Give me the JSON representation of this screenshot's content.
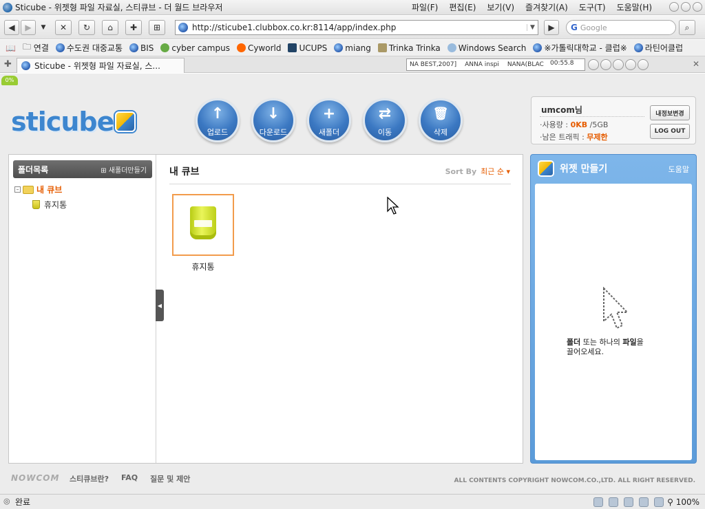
{
  "window": {
    "title": "Sticube - 위젯형 파일 자료실, 스티큐브 - 더 월드 브라우저",
    "menu": [
      "파일(F)",
      "편집(E)",
      "보기(V)",
      "즐겨찾기(A)",
      "도구(T)",
      "도움말(H)"
    ]
  },
  "navbar": {
    "url": "http://sticube1.clubbox.co.kr:8114/app/index.php",
    "search_placeholder": "Google",
    "search_engine": "G"
  },
  "bookmarks": [
    "연결",
    "수도권 대중교통",
    "BIS",
    "cyber campus",
    "Cyworld",
    "UCUPS",
    "miang",
    "Trinka Trinka",
    "Windows Search",
    "※가톨릭대학교 - 클럽※",
    "라틴어클럽"
  ],
  "tab": {
    "label": "Sticube - 위젯형 파일 자료실, 스..."
  },
  "media": {
    "track1": "NA BEST,2007]",
    "track2": "ANNA inspi",
    "track3": "NANA(BLAC",
    "time": "00:55.8"
  },
  "page": {
    "progress": "0%",
    "logo": "sticube",
    "actions": [
      {
        "label": "업로드",
        "icon": "upload-arrow-icon",
        "glyph": "↑"
      },
      {
        "label": "다운로드",
        "icon": "download-arrow-icon",
        "glyph": "↓"
      },
      {
        "label": "새폴더",
        "icon": "plus-icon",
        "glyph": "+"
      },
      {
        "label": "이동",
        "icon": "move-icon",
        "glyph": "⇄"
      },
      {
        "label": "삭제",
        "icon": "trash-icon",
        "glyph": "🗑"
      }
    ],
    "account": {
      "username": "umcom님",
      "usage_label": "·사용량 :",
      "usage_value": "0KB",
      "usage_total": "/5GB",
      "traffic_label": "·남은 트래픽 :",
      "traffic_value": "무제한",
      "edit_button": "내정보변경",
      "logout_button": "LOG OUT"
    },
    "sidebar": {
      "title": "폴더목록",
      "new_folder": "⊞ 새폴더만들기",
      "root": "내 큐브",
      "child": "휴지통"
    },
    "main": {
      "title": "내 큐브",
      "sort_label": "Sort By",
      "sort_value": "최근 순 ▾",
      "files": [
        {
          "name": "휴지통"
        }
      ]
    },
    "widget": {
      "title": "위젯 만들기",
      "help": "도움말",
      "msg_part1": "폴더",
      "msg_part2": " 또는 하나의 ",
      "msg_part3": "파일",
      "msg_part4": "을",
      "msg_line2": "끌어오세요."
    },
    "footer": {
      "logo": "NOWCOM",
      "links": [
        "스티큐브란?",
        "FAQ",
        "질문 및 제안"
      ],
      "copyright": "ALL CONTENTS COPYRIGHT NOWCOM.CO.,LTD. ALL RIGHT RESERVED."
    }
  },
  "status": {
    "text": "완료",
    "zoom": "100%"
  },
  "colors": {
    "accent": "#3d86cf",
    "highlight": "#e65c00",
    "widget": "#6aa6e2"
  }
}
